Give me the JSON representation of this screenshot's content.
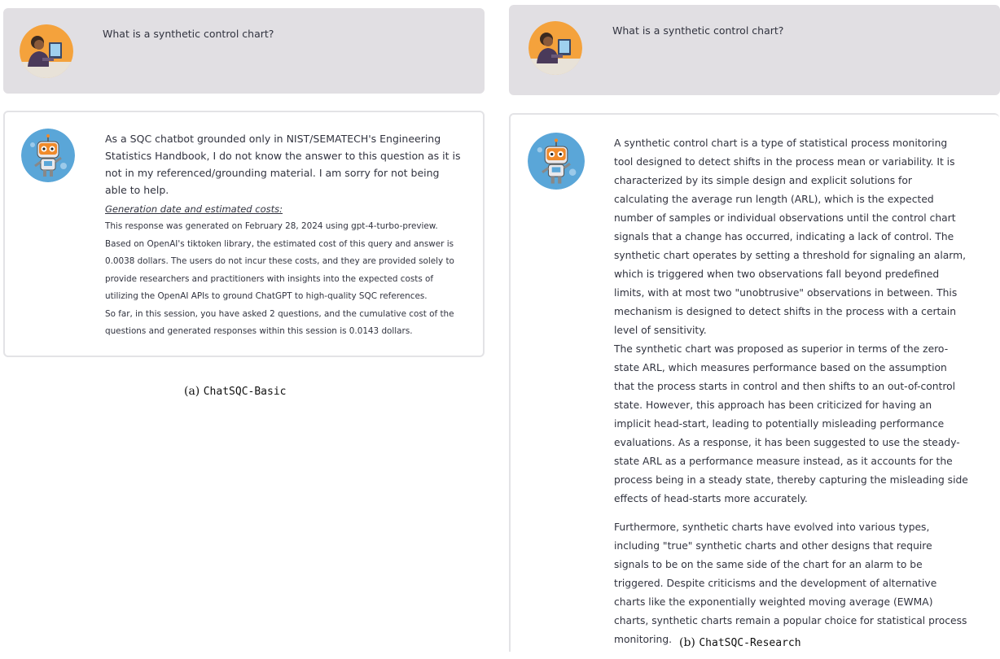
{
  "panel_a": {
    "question": "What is a synthetic control chart?",
    "answer": "As a SQC chatbot grounded only in NIST/SEMATECH's Engineering Statistics Handbook, I do not know the answer to this question as it is not in my referenced/grounding material. I am sorry for not being able to help.",
    "generation_title": "Generation date and estimated costs:",
    "generation_text": "This response was generated on February 28, 2024 using gpt-4-turbo-preview. Based on OpenAI's tiktoken library, the estimated cost of this query and answer is 0.0038 dollars. The users do not incur these costs, and they are provided solely to provide researchers and practitioners with insights into the expected costs of utilizing the OpenAI APIs to ground ChatGPT to high-quality SQC references.",
    "session_text": "So far, in this session, you have asked 2 questions, and the cumulative cost of the questions and generated responses within this session is 0.0143 dollars.",
    "caption_prefix": "(a) ",
    "caption_name": "ChatSQC-Basic"
  },
  "panel_b": {
    "question": "What is a synthetic control chart?",
    "paragraphs": [
      "A synthetic control chart is a type of statistical process monitoring tool designed to detect shifts in the process mean or variability. It is characterized by its simple design and explicit solutions for calculating the average run length (ARL), which is the expected number of samples or individual observations until the control chart signals that a change has occurred, indicating a lack of control. The synthetic chart operates by setting a threshold for signaling an alarm, which is triggered when two observations fall beyond predefined limits, with at most two \"unobtrusive\" observations in between. This mechanism is designed to detect shifts in the process with a certain level of sensitivity.",
      "The synthetic chart was proposed as superior in terms of the zero-state ARL, which measures performance based on the assumption that the process starts in control and then shifts to an out-of-control state. However, this approach has been criticized for having an implicit head-start, leading to potentially misleading performance evaluations. As a response, it has been suggested to use the steady-state ARL as a performance measure instead, as it accounts for the process being in a steady state, thereby capturing the misleading side effects of head-starts more accurately.",
      "Furthermore, synthetic charts have evolved into various types, including \"true\" synthetic charts and other designs that require signals to be on the same side of the chart for an alarm to be triggered. Despite criticisms and the development of alternative charts like the exponentially weighted moving average (EWMA) charts, synthetic charts remain a popular choice for statistical process monitoring."
    ],
    "caption_prefix": "(b) ",
    "caption_name": "ChatSQC-Research"
  },
  "colors": {
    "user_box_bg": "#e1dfe3",
    "bot_border": "#e3e3e6",
    "text": "#31333f",
    "user_avatar_bg": "#f4a23c",
    "bot_avatar_bg": "#5aa6d8"
  },
  "icons": {
    "user_avatar": "person-at-computer-avatar",
    "bot_avatar": "robot-avatar"
  }
}
